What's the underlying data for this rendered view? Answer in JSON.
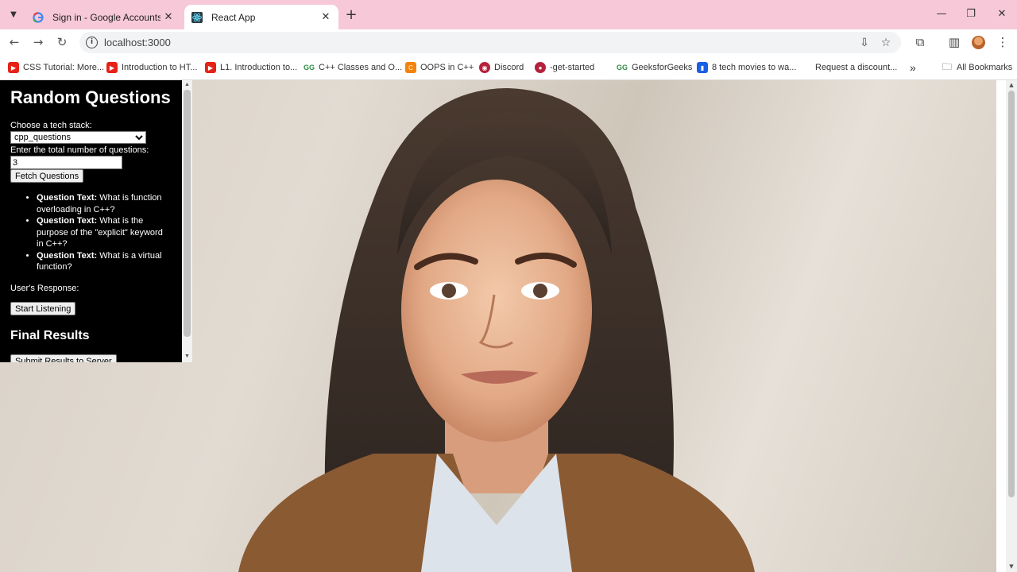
{
  "browser": {
    "tabs": [
      {
        "title": "Sign in - Google Accounts",
        "icon": "google-icon"
      },
      {
        "title": "React App",
        "icon": "react-icon"
      }
    ],
    "url": "localhost:3000",
    "bookmarks": [
      {
        "label": "CSS Tutorial: More...",
        "icon": "youtube-icon"
      },
      {
        "label": "Introduction to HT...",
        "icon": "youtube-icon"
      },
      {
        "label": "L1. Introduction to...",
        "icon": "youtube-icon"
      },
      {
        "label": "C++ Classes and O...",
        "icon": "geeksforgeeks-icon"
      },
      {
        "label": "OOPS in C++",
        "icon": "codehelp-icon"
      },
      {
        "label": "Discord",
        "icon": "discord-icon"
      },
      {
        "label": "-get-started",
        "icon": "site-icon"
      },
      {
        "label": "GeeksforGeeks",
        "icon": "geeksforgeeks-icon"
      },
      {
        "label": "8 tech movies to wa...",
        "icon": "doc-icon"
      },
      {
        "label": "Request a discount...",
        "icon": "none"
      }
    ],
    "all_bookmarks_label": "All Bookmarks"
  },
  "app": {
    "title": "Random Questions",
    "tech_stack_label": "Choose a tech stack:",
    "tech_stack_value": "cpp_questions",
    "count_label": "Enter the total number of questions:",
    "count_value": "3",
    "fetch_button": "Fetch Questions",
    "question_prefix": "Question Text:",
    "questions": [
      "What is function overloading in C++?",
      "What is the purpose of the \"explicit\" keyword in C++?",
      "What is a virtual function?"
    ],
    "response_label": "User's Response:",
    "listen_button": "Start Listening",
    "final_results_heading": "Final Results",
    "submit_button": "Submit Results to Server"
  }
}
